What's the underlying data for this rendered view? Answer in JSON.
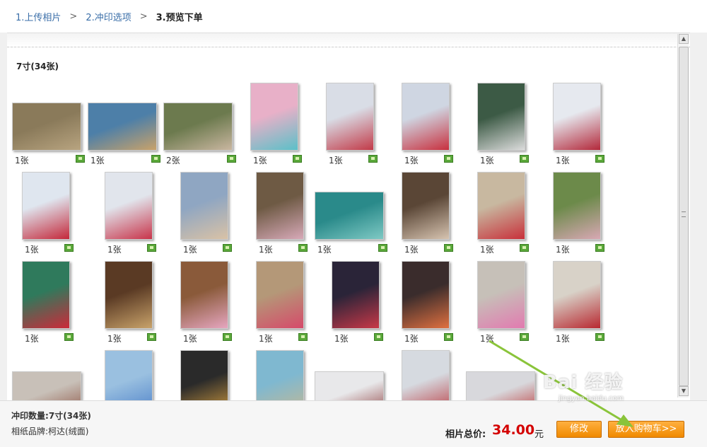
{
  "breadcrumb": {
    "step1": "1.上传相片",
    "sep": ">",
    "step2": "2.冲印选项",
    "step3": "3.预览下单"
  },
  "section": {
    "title": "7寸(34张)"
  },
  "photos": [
    {
      "qty": "1张",
      "colors": [
        "#8a7a5a",
        "#b8a480"
      ]
    },
    {
      "qty": "1张",
      "colors": [
        "#4d7fa8",
        "#c9a26a"
      ]
    },
    {
      "qty": "2张",
      "colors": [
        "#6c7a4e",
        "#c9b6a0"
      ]
    },
    {
      "qty": "1张",
      "colors": [
        "#e8b0c8",
        "#5bc0c8"
      ]
    },
    {
      "qty": "1张",
      "colors": [
        "#d9dde6",
        "#c23a48"
      ]
    },
    {
      "qty": "1张",
      "colors": [
        "#cfd6e2",
        "#c8303e"
      ]
    },
    {
      "qty": "1张",
      "colors": [
        "#3c5a45",
        "#dcdcdc"
      ]
    },
    {
      "qty": "1张",
      "colors": [
        "#e6e9ef",
        "#b3283a"
      ]
    },
    {
      "qty": "1张",
      "colors": [
        "#dfe6ef",
        "#c4283a"
      ]
    },
    {
      "qty": "1张",
      "colors": [
        "#e1e5ec",
        "#c8344a"
      ]
    },
    {
      "qty": "1张",
      "colors": [
        "#8fa6c2",
        "#d9c2a6"
      ]
    },
    {
      "qty": "1张",
      "colors": [
        "#6e5a44",
        "#d7a9b8"
      ]
    },
    {
      "qty": "1张",
      "colors": [
        "#2a8a8a",
        "#7fc9c4"
      ]
    },
    {
      "qty": "1张",
      "colors": [
        "#5a4636",
        "#d6c3b0"
      ]
    },
    {
      "qty": "1张",
      "colors": [
        "#c8b8a0",
        "#c8303a"
      ]
    },
    {
      "qty": "1张",
      "colors": [
        "#6c8a4a",
        "#d8a8b4"
      ]
    },
    {
      "qty": "1张",
      "colors": [
        "#2f7a5c",
        "#cc2a3a"
      ]
    },
    {
      "qty": "1张",
      "colors": [
        "#5a3a24",
        "#c8a26a"
      ]
    },
    {
      "qty": "1张",
      "colors": [
        "#8a5a3a",
        "#e6a6c0"
      ]
    },
    {
      "qty": "1张",
      "colors": [
        "#b49878",
        "#d64a6a"
      ]
    },
    {
      "qty": "1张",
      "colors": [
        "#2a2438",
        "#c83848"
      ]
    },
    {
      "qty": "1张",
      "colors": [
        "#3a2c2c",
        "#e07040"
      ]
    },
    {
      "qty": "1张",
      "colors": [
        "#c6c0b8",
        "#e27ab0"
      ]
    },
    {
      "qty": "1张",
      "colors": [
        "#d8d2c8",
        "#b82830"
      ]
    },
    {
      "qty": "",
      "colors": [
        "#c8c0b8",
        "#8a5040"
      ]
    },
    {
      "qty": "",
      "colors": [
        "#9ac0e0",
        "#4a7ec8"
      ]
    },
    {
      "qty": "",
      "colors": [
        "#2a2a2a",
        "#d8a040"
      ]
    },
    {
      "qty": "",
      "colors": [
        "#7fb8d0",
        "#c8b890"
      ]
    },
    {
      "qty": "",
      "colors": [
        "#e8e8ea",
        "#8a3a3a"
      ]
    },
    {
      "qty": "",
      "colors": [
        "#d6dae0",
        "#b8343a"
      ]
    },
    {
      "qty": "",
      "colors": [
        "#d8d8dc",
        "#b83030"
      ]
    }
  ],
  "footer": {
    "qty_label": "冲印数量:",
    "qty_value": "7寸(34张)",
    "brand_label": "相纸品牌:",
    "brand_value": "柯达(绒面)",
    "total_label": "相片总价:",
    "total_value": "34.00",
    "total_unit": "元",
    "edit_label": "修改",
    "cart_label": "放入购物车>>"
  },
  "watermark": {
    "text": "Bai 经验",
    "url": "jingyan.baidu.com"
  },
  "colors": {
    "accent_orange": "#f08a00",
    "price_red": "#d40000",
    "link_blue": "#3a6ea8",
    "arrow_green": "#8ac43a"
  }
}
